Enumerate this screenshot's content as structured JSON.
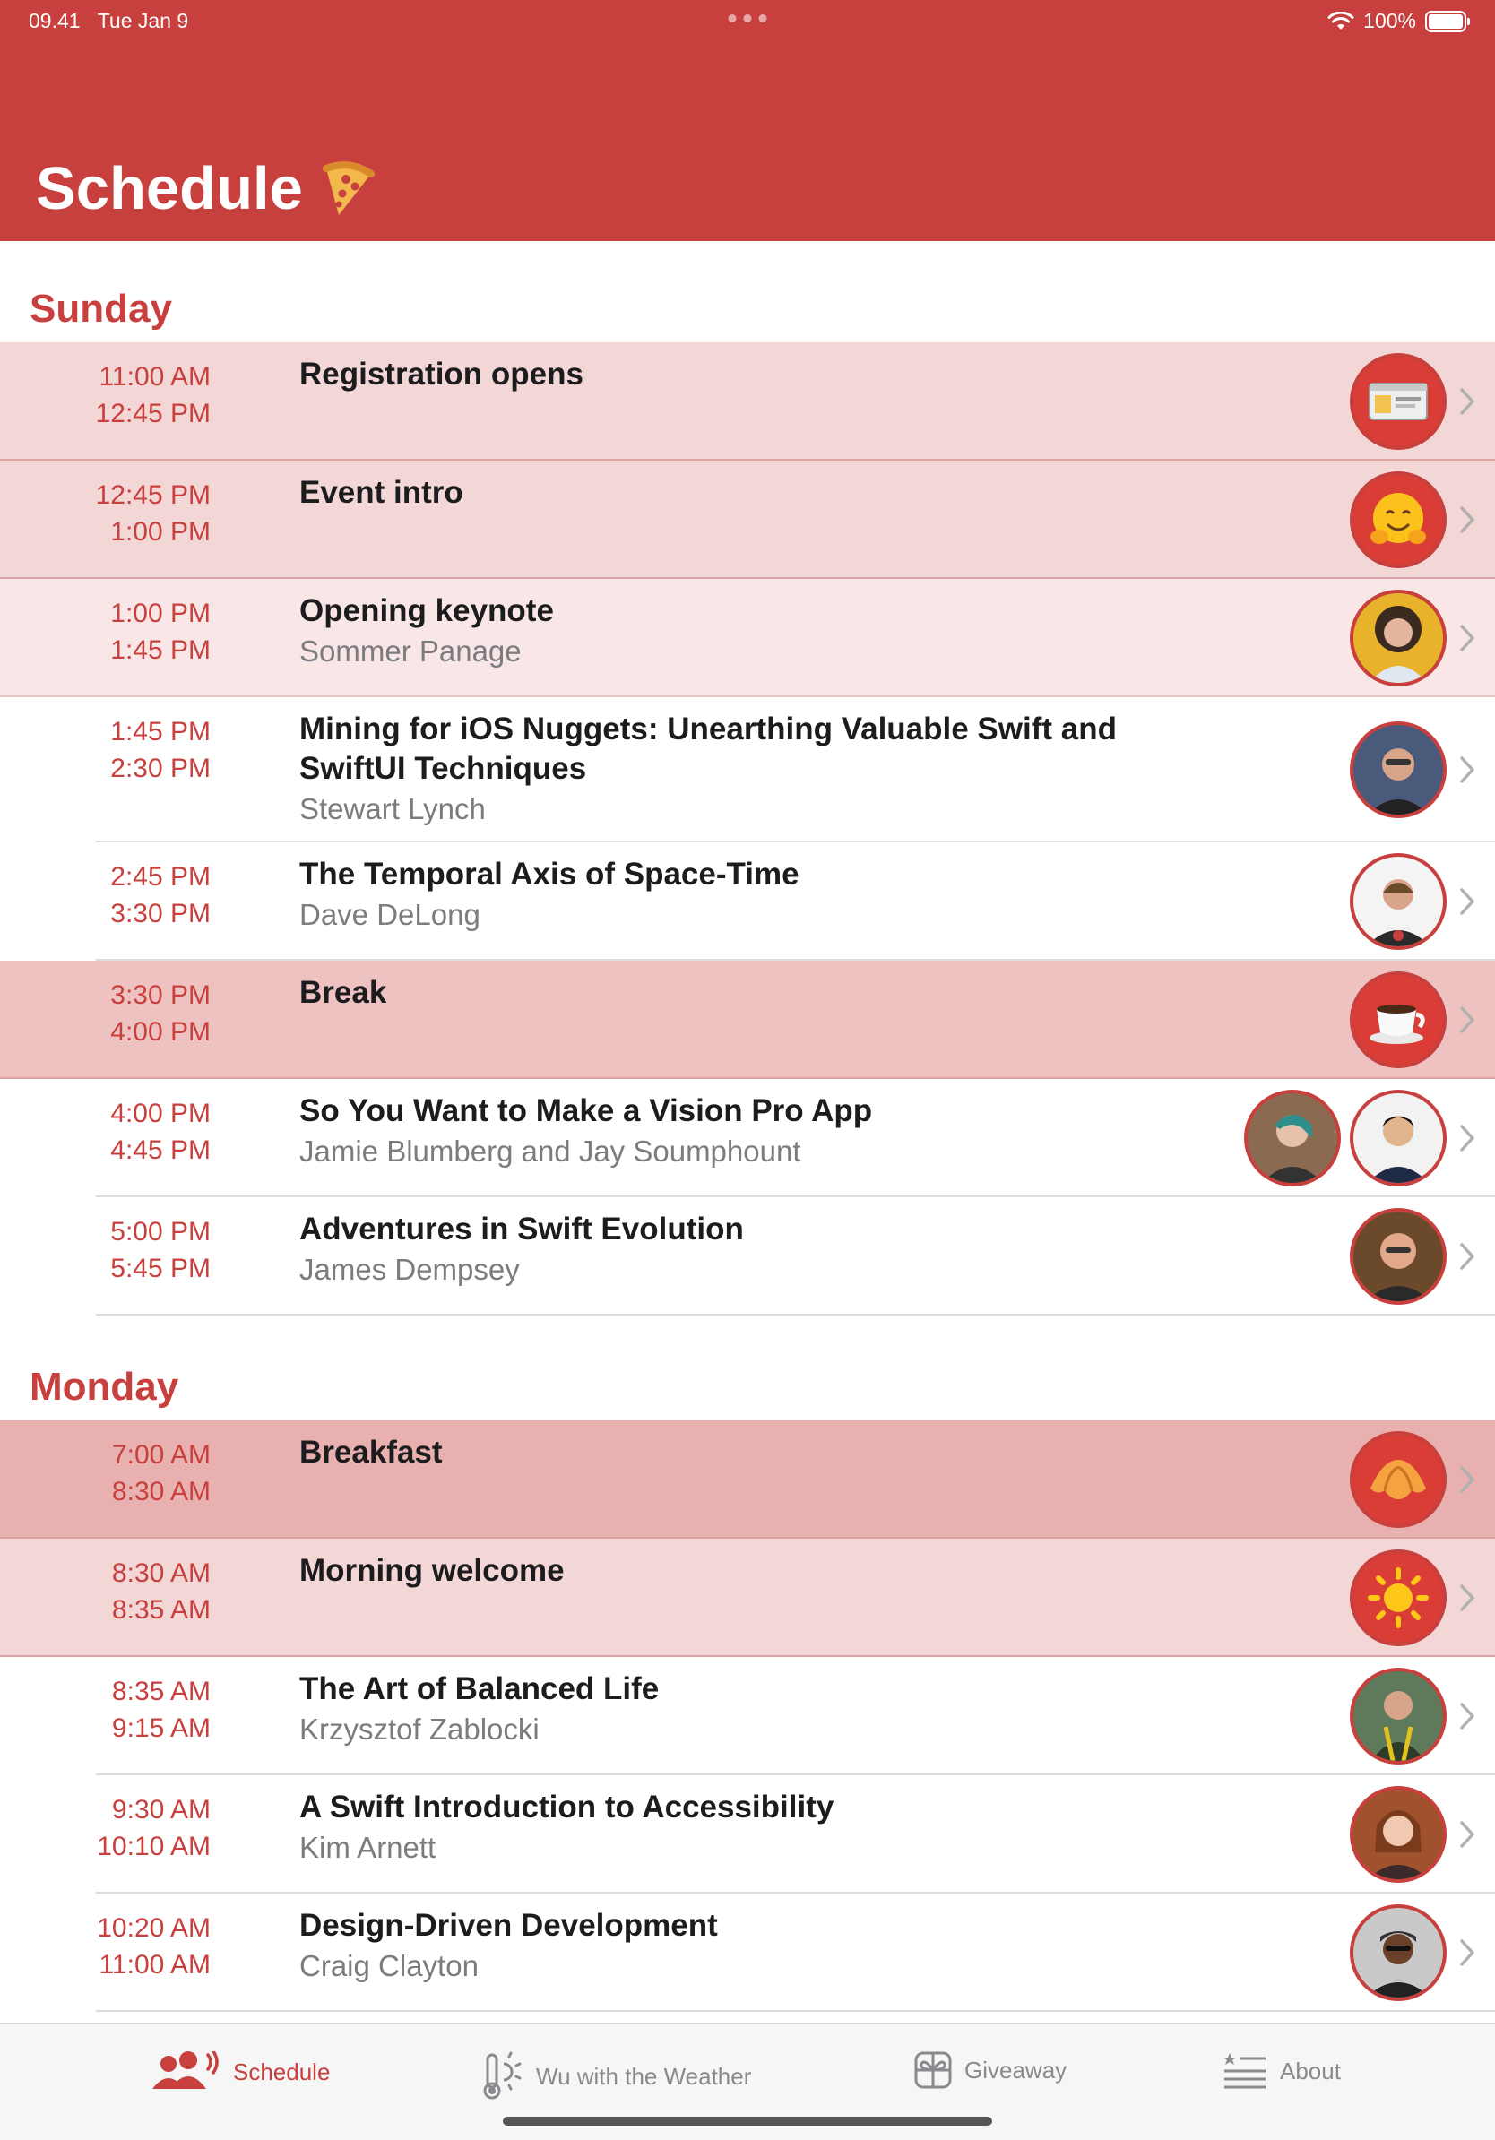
{
  "status_bar": {
    "time": "09.41",
    "date": "Tue Jan 9",
    "battery": "100%"
  },
  "header": {
    "title": "Schedule"
  },
  "days": [
    {
      "label": "Sunday",
      "items": [
        {
          "start": "11:00 AM",
          "end": "12:45 PM",
          "title": "Registration opens",
          "speaker": "",
          "icon": "id-card-icon"
        },
        {
          "start": "12:45 PM",
          "end": "1:00 PM",
          "title": "Event intro",
          "speaker": "",
          "icon": "hugging-face-icon"
        },
        {
          "start": "1:00 PM",
          "end": "1:45 PM",
          "title": "Opening keynote",
          "speaker": "Sommer Panage",
          "icon": "speaker-photo"
        },
        {
          "start": "1:45 PM",
          "end": "2:30 PM",
          "title": "Mining for iOS Nuggets: Unearthing Valuable Swift and SwiftUI Techniques",
          "speaker": "Stewart Lynch",
          "icon": "speaker-photo"
        },
        {
          "start": "2:45 PM",
          "end": "3:30 PM",
          "title": "The Temporal Axis of Space-Time",
          "speaker": "Dave DeLong",
          "icon": "speaker-photo"
        },
        {
          "start": "3:30 PM",
          "end": "4:00 PM",
          "title": "Break",
          "speaker": "",
          "icon": "coffee-icon"
        },
        {
          "start": "4:00 PM",
          "end": "4:45 PM",
          "title": "So You Want to Make a Vision Pro App",
          "speaker": "Jamie Blumberg and Jay Soumphount",
          "icon": "speaker-photo"
        },
        {
          "start": "5:00 PM",
          "end": "5:45 PM",
          "title": "Adventures in Swift Evolution",
          "speaker": "James Dempsey",
          "icon": "speaker-photo"
        }
      ]
    },
    {
      "label": "Monday",
      "items": [
        {
          "start": "7:00 AM",
          "end": "8:30 AM",
          "title": "Breakfast",
          "speaker": "",
          "icon": "croissant-icon"
        },
        {
          "start": "8:30 AM",
          "end": "8:35 AM",
          "title": "Morning welcome",
          "speaker": "",
          "icon": "sun-icon"
        },
        {
          "start": "8:35 AM",
          "end": "9:15 AM",
          "title": "The Art of Balanced Life",
          "speaker": "Krzysztof Zablocki",
          "icon": "speaker-photo"
        },
        {
          "start": "9:30 AM",
          "end": "10:10 AM",
          "title": "A Swift Introduction to Accessibility",
          "speaker": "Kim Arnett",
          "icon": "speaker-photo"
        },
        {
          "start": "10:20 AM",
          "end": "11:00 AM",
          "title": "Design-Driven Development",
          "speaker": "Craig Clayton",
          "icon": "speaker-photo"
        }
      ]
    }
  ],
  "tabs": [
    {
      "label": "Schedule",
      "icon": "people-icon",
      "active": true
    },
    {
      "label": "Wu with the Weather",
      "icon": "thermometer-sun-icon",
      "active": false
    },
    {
      "label": "Giveaway",
      "icon": "gift-icon",
      "active": false
    },
    {
      "label": "About",
      "icon": "about-list-icon",
      "active": false
    }
  ],
  "colors": {
    "accent": "#c8403d",
    "secondary_text": "#7c7c80"
  }
}
